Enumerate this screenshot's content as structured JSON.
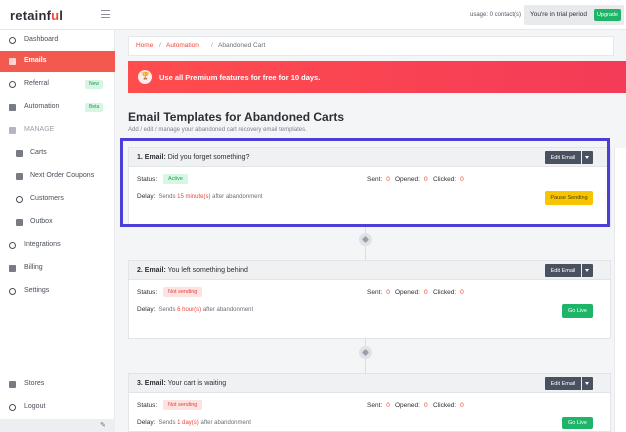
{
  "header": {
    "logo_main": "retainf",
    "logo_accent": "u",
    "logo_end": "l",
    "usage": "usage: 0 contact(s)",
    "trial_text": "You're in trial period",
    "upgrade_label": "Upgrade"
  },
  "sidebar": {
    "items": [
      {
        "label": "Dashboard",
        "icon": "dashboard-icon"
      },
      {
        "label": "Emails",
        "icon": "email-icon"
      },
      {
        "label": "Referral",
        "icon": "referral-icon",
        "badge": "New"
      },
      {
        "label": "Automation",
        "icon": "automation-icon",
        "badge": "Beta"
      },
      {
        "label": "MANAGE",
        "icon": "gear-icon"
      },
      {
        "label": "Carts",
        "icon": "cart-icon"
      },
      {
        "label": "Next Order Coupons",
        "icon": "coupon-icon"
      },
      {
        "label": "Customers",
        "icon": "customers-icon"
      },
      {
        "label": "Outbox",
        "icon": "outbox-icon"
      },
      {
        "label": "Integrations",
        "icon": "integrations-icon"
      },
      {
        "label": "Billing",
        "icon": "billing-icon"
      },
      {
        "label": "Settings",
        "icon": "settings-icon"
      },
      {
        "label": "Stores",
        "icon": "stores-icon"
      },
      {
        "label": "Logout",
        "icon": "logout-icon"
      }
    ],
    "footer_icon": "pencil-icon"
  },
  "breadcrumb": {
    "home": "Home",
    "sep": "/",
    "automation": "Automation",
    "current": "Abandoned Cart"
  },
  "banner": {
    "text": "Use all Premium features for free for 10 days.",
    "icon": "trophy-icon"
  },
  "page": {
    "title": "Email Templates for Abandoned Carts",
    "subtitle": "Add / edit / manage your abandoned cart recovery email templates."
  },
  "labels": {
    "status": "Status:",
    "sent": "Sent:",
    "opened": "Opened:",
    "clicked": "Clicked:",
    "delay": "Delay:",
    "edit_email": "Edit Email"
  },
  "templates": [
    {
      "number": "1. Email:",
      "subject": "Did you forget something?",
      "status": "Active",
      "sent": "0",
      "opened": "0",
      "clicked": "0",
      "delay_pre": "Sends",
      "delay_value": "15 minute(s)",
      "delay_post": "after abandonment",
      "action": "Pause Sending"
    },
    {
      "number": "2. Email:",
      "subject": "You left something behind",
      "status": "Not sending",
      "sent": "0",
      "opened": "0",
      "clicked": "0",
      "delay_pre": "Sends",
      "delay_value": "6 hour(s)",
      "delay_post": "after abandonment",
      "action": "Go Live"
    },
    {
      "number": "3. Email:",
      "subject": "Your cart is waiting",
      "status": "Not sending",
      "sent": "0",
      "opened": "0",
      "clicked": "0",
      "delay_pre": "Sends",
      "delay_value": "1 day(s)",
      "delay_post": "after abandonment",
      "action": "Go Live"
    }
  ],
  "colors": {
    "accent": "#f4594f",
    "banner": "#ff4d4d",
    "success": "#1eb568",
    "warning": "#f7c500",
    "highlight": "#4b3fd8"
  }
}
